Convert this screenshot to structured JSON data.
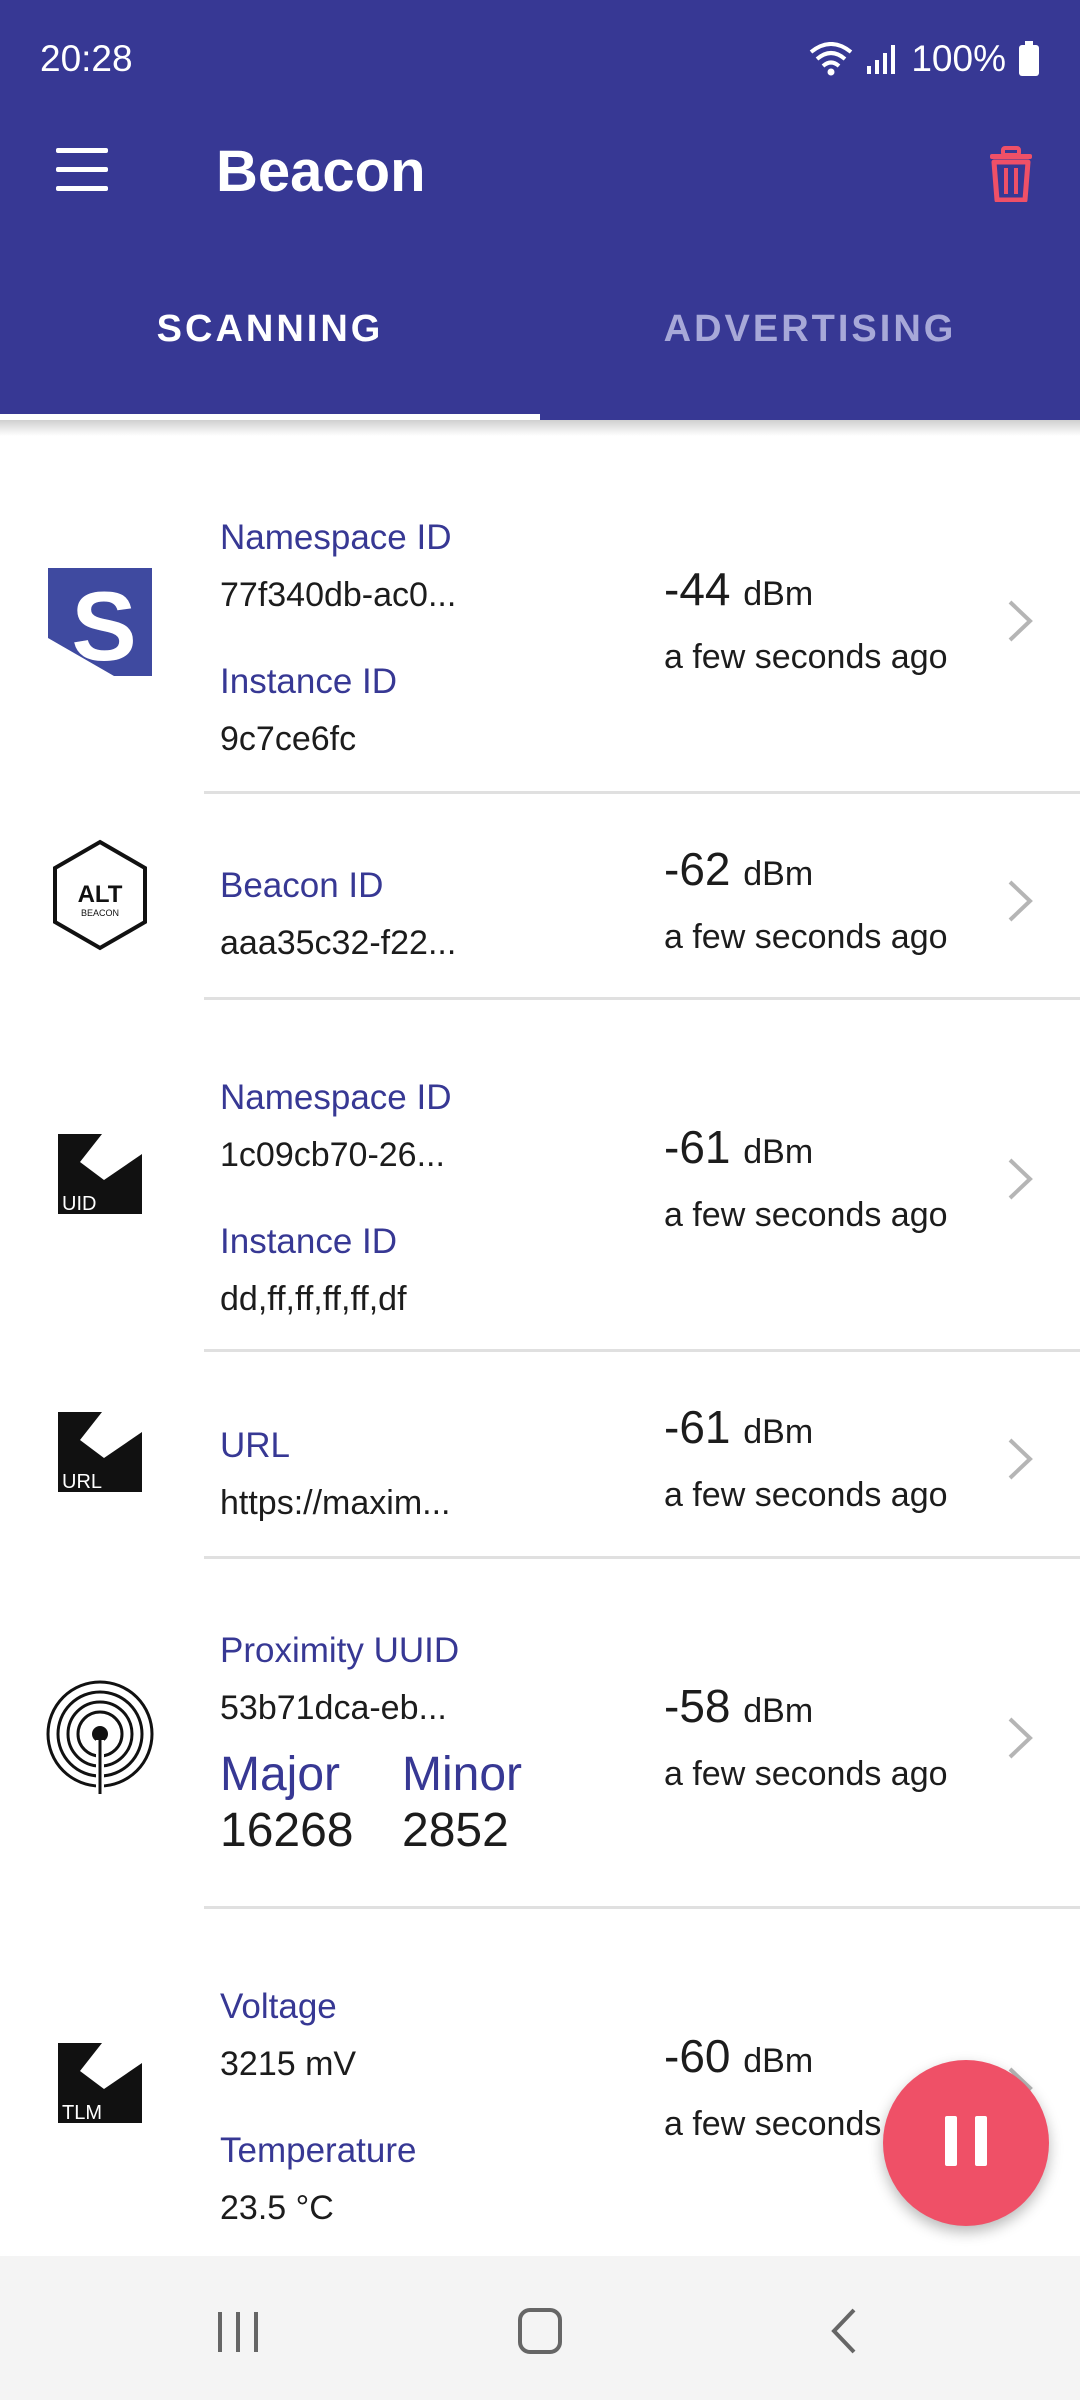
{
  "status": {
    "time": "20:28",
    "battery": "100%"
  },
  "appbar": {
    "title": "Beacon"
  },
  "tabs": [
    {
      "label": "SCANNING",
      "active": true
    },
    {
      "label": "ADVERTISING",
      "active": false
    }
  ],
  "beacons": [
    {
      "icon": "eddystone-logo-icon",
      "label1": "Namespace ID",
      "value1": "77f340db-ac0...",
      "label2": "Instance ID",
      "value2": "9c7ce6fc",
      "rssi": "-44",
      "unit": "dBm",
      "ago": "a few seconds ago"
    },
    {
      "icon": "altbeacon-logo-icon",
      "badge": "ALT",
      "badge_sub": "BEACON",
      "label1": "Beacon ID",
      "value1": "aaa35c32-f22...",
      "rssi": "-62",
      "unit": "dBm",
      "ago": "a few seconds ago"
    },
    {
      "icon": "eddystone-uid-icon",
      "badge": "UID",
      "label1": "Namespace ID",
      "value1": "1c09cb70-26...",
      "label2": "Instance ID",
      "value2": "dd,ff,ff,ff,ff,df",
      "rssi": "-61",
      "unit": "dBm",
      "ago": "a few seconds ago"
    },
    {
      "icon": "eddystone-url-icon",
      "badge": "URL",
      "label1": "URL",
      "value1": "https://maxim...",
      "rssi": "-61",
      "unit": "dBm",
      "ago": "a few seconds ago"
    },
    {
      "icon": "ibeacon-icon",
      "label1": "Proximity UUID",
      "value1": "53b71dca-eb...",
      "major_label": "Major",
      "major": "16268",
      "minor_label": "Minor",
      "minor": "2852",
      "rssi": "-58",
      "unit": "dBm",
      "ago": "a few seconds ago"
    },
    {
      "icon": "eddystone-tlm-icon",
      "badge": "TLM",
      "label1": "Voltage",
      "value1": "3215 mV",
      "label2": "Temperature",
      "value2": "23.5 °C",
      "rssi": "-60",
      "unit": "dBm",
      "ago": "a few seconds ago"
    }
  ],
  "colors": {
    "primary": "#373894",
    "accent": "#ef5067",
    "trash": "#ef5067"
  }
}
